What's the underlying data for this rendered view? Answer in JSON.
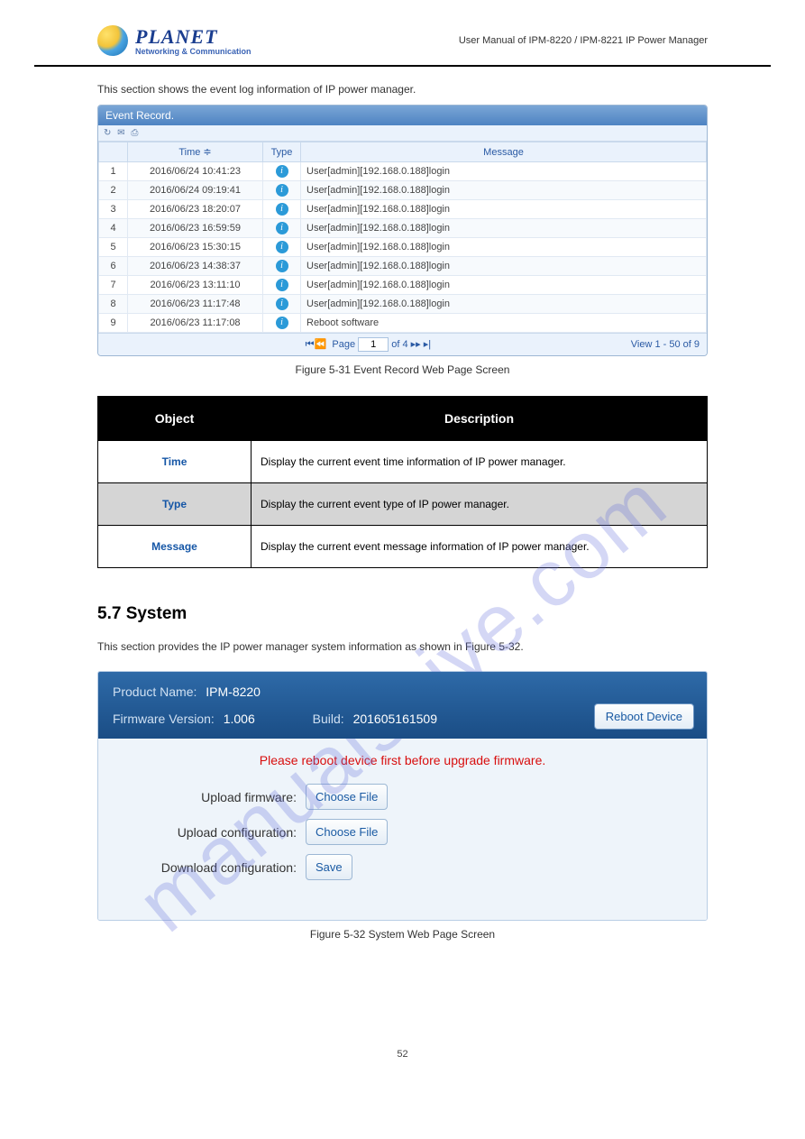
{
  "header": {
    "brand": "PLANET",
    "tagline": "Networking & Communication",
    "doc_title": "User Manual of IPM-8220 / IPM-8221 IP Power Manager"
  },
  "intro1": "This section shows the event log information of IP power manager.",
  "event_panel": {
    "title": "Event Record.",
    "toolbar_icons": [
      "↻",
      "✉",
      "⎙"
    ],
    "columns": {
      "time": "Time ≑",
      "type": "Type",
      "message": "Message"
    },
    "rows": [
      {
        "idx": "1",
        "time": "2016/06/24 10:41:23",
        "msg": "User[admin][192.168.0.188]login"
      },
      {
        "idx": "2",
        "time": "2016/06/24 09:19:41",
        "msg": "User[admin][192.168.0.188]login"
      },
      {
        "idx": "3",
        "time": "2016/06/23 18:20:07",
        "msg": "User[admin][192.168.0.188]login"
      },
      {
        "idx": "4",
        "time": "2016/06/23 16:59:59",
        "msg": "User[admin][192.168.0.188]login"
      },
      {
        "idx": "5",
        "time": "2016/06/23 15:30:15",
        "msg": "User[admin][192.168.0.188]login"
      },
      {
        "idx": "6",
        "time": "2016/06/23 14:38:37",
        "msg": "User[admin][192.168.0.188]login"
      },
      {
        "idx": "7",
        "time": "2016/06/23 13:11:10",
        "msg": "User[admin][192.168.0.188]login"
      },
      {
        "idx": "8",
        "time": "2016/06/23 11:17:48",
        "msg": "User[admin][192.168.0.188]login"
      },
      {
        "idx": "9",
        "time": "2016/06/23 11:17:08",
        "msg": "Reboot software"
      }
    ],
    "pager": {
      "nav_first": "⏮⏪",
      "page_label_pre": "Page",
      "page_value": "1",
      "page_label_post": "of 4  ▸▸  ▸|",
      "view_summary": "View 1 - 50 of 9"
    }
  },
  "fig531": "Figure 5-31 Event Record Web Page Screen",
  "desc_table": {
    "head_obj": "Object",
    "head_desc": "Description",
    "rows": [
      {
        "obj": "Time",
        "desc": "Display the current event time information of IP power manager.",
        "shade": false
      },
      {
        "obj": "Type",
        "desc": "Display the current event type of IP power manager.",
        "shade": true
      },
      {
        "obj": "Message",
        "desc": "Display the current event message information of IP power manager.",
        "shade": false
      }
    ]
  },
  "sys_heading": "5.7 System",
  "intro2": "This section provides the IP power manager system information as shown in Figure 5-32.",
  "sys_panel": {
    "product_label": "Product Name:",
    "product_value": "IPM-8220",
    "fw_label": "Firmware Version:",
    "fw_value": "1.006",
    "build_label": "Build:",
    "build_value": "201605161509",
    "reboot_btn": "Reboot Device",
    "warn": "Please reboot device first before upgrade firmware.",
    "form": {
      "upload_fw_label": "Upload firmware:",
      "upload_fw_btn": "Choose File",
      "upload_cfg_label": "Upload configuration:",
      "upload_cfg_btn": "Choose File",
      "download_cfg_label": "Download configuration:",
      "download_cfg_btn": "Save"
    }
  },
  "fig532": "Figure 5-32 System Web Page Screen",
  "watermark": "manualshive.com",
  "page_number": "52"
}
